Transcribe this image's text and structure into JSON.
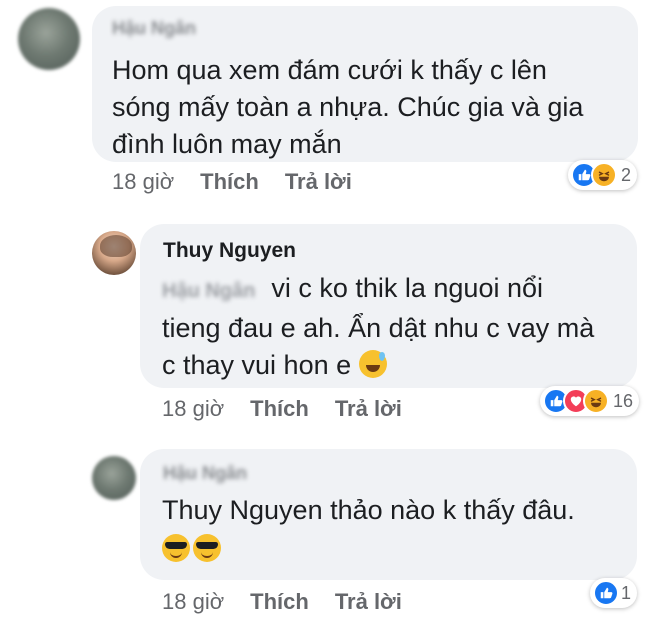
{
  "comments": [
    {
      "author": "Hậu Ngân",
      "text_lines": [
        "Hom qua xem đám cưới k thấy c lên",
        "sóng mấy toàn a nhựa. Chúc gia và gia",
        "đình luôn may mắn"
      ],
      "time": "18 giờ",
      "like_label": "Thích",
      "reply_label": "Trả lời",
      "reaction_count": "2",
      "reactions": [
        "like-icon",
        "haha-icon"
      ]
    },
    {
      "author": "Thuy Nguyen",
      "mention": "Hậu Ngân",
      "text_lines": [
        "vi c ko thik la nguoi nổi",
        "tieng đau e ah. Ẩn dật nhu c vay mà",
        "c thay vui hon e"
      ],
      "time": "18 giờ",
      "like_label": "Thích",
      "reply_label": "Trả lời",
      "reaction_count": "16",
      "reactions": [
        "like-icon",
        "love-icon",
        "haha-icon"
      ]
    },
    {
      "author": "Hậu Ngân",
      "text_lines": [
        "Thuy Nguyen thảo nào k thấy đâu."
      ],
      "time": "18 giờ",
      "like_label": "Thích",
      "reply_label": "Trả lời",
      "reaction_count": "1",
      "reactions": [
        "like-icon"
      ]
    }
  ],
  "colors": {
    "bubble": "#f0f2f5",
    "meta": "#65676b",
    "like": "#1877f2",
    "love": "#f33e58",
    "haha": "#f7b125"
  }
}
